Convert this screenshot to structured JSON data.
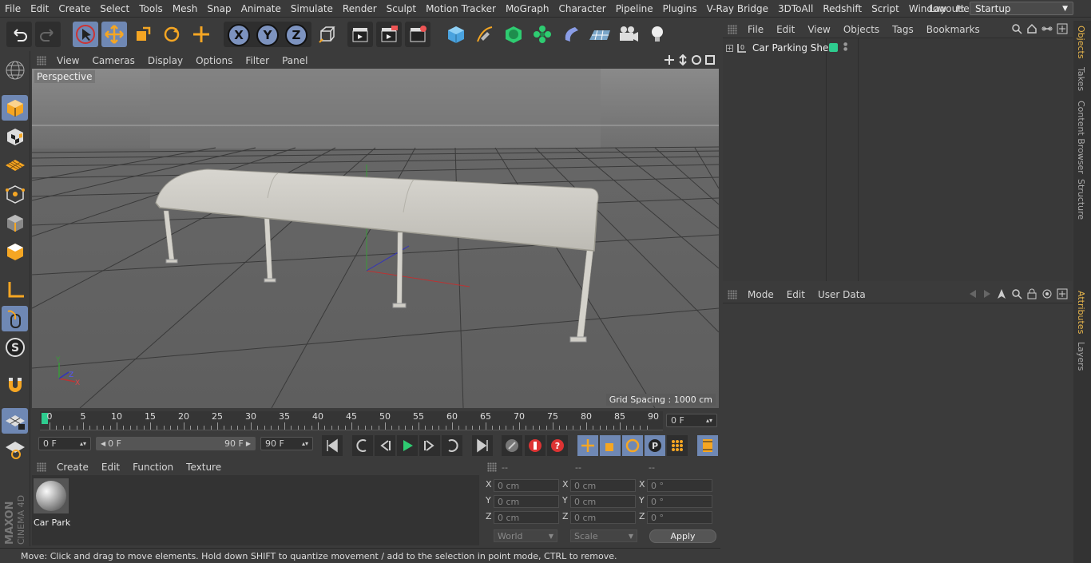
{
  "menubar": {
    "items": [
      "File",
      "Edit",
      "Create",
      "Select",
      "Tools",
      "Mesh",
      "Snap",
      "Animate",
      "Simulate",
      "Render",
      "Sculpt",
      "Motion Tracker",
      "MoGraph",
      "Character",
      "Pipeline",
      "Plugins",
      "V-Ray Bridge",
      "3DToAll",
      "Redshift",
      "Script",
      "Window",
      "Help"
    ],
    "layout_label": "Layout:",
    "layout_value": "Startup"
  },
  "toolbar": {
    "axis_x": "X",
    "axis_y": "Y",
    "axis_z": "Z"
  },
  "viewport": {
    "menu": [
      "View",
      "Cameras",
      "Display",
      "Options",
      "Filter",
      "Panel"
    ],
    "label": "Perspective",
    "grid_spacing": "Grid Spacing : 1000 cm",
    "axis_y": "Y",
    "axis_z": "Z",
    "axis_x": "X"
  },
  "timeline": {
    "ticks": [
      "0",
      "5",
      "10",
      "15",
      "20",
      "25",
      "30",
      "35",
      "40",
      "45",
      "50",
      "55",
      "60",
      "65",
      "70",
      "75",
      "80",
      "85",
      "90"
    ],
    "current_frame": "0 F"
  },
  "transport": {
    "start_field": "0 F",
    "range_start": "0 F",
    "range_end": "90 F",
    "end_field": "90 F"
  },
  "materials": {
    "menu": [
      "Create",
      "Edit",
      "Function",
      "Texture"
    ],
    "items": [
      {
        "name": "Car Park"
      }
    ]
  },
  "coordinates": {
    "headers": [
      "--",
      "--",
      "--"
    ],
    "rows": [
      {
        "axis": "X",
        "pos": "0 cm",
        "size_axis": "X",
        "size": "0 cm",
        "rot_axis": "X",
        "rot": "0 °"
      },
      {
        "axis": "Y",
        "pos": "0 cm",
        "size_axis": "Y",
        "size": "0 cm",
        "rot_axis": "Y",
        "rot": "0 °"
      },
      {
        "axis": "Z",
        "pos": "0 cm",
        "size_axis": "Z",
        "size": "0 cm",
        "rot_axis": "Z",
        "rot": "0 °"
      }
    ],
    "mode_select": "World",
    "scale_select": "Scale",
    "apply_label": "Apply"
  },
  "status": "Move: Click and drag to move elements. Hold down SHIFT to quantize movement / add to the selection in point mode, CTRL to remove.",
  "objects": {
    "menu": [
      "File",
      "Edit",
      "View",
      "Objects",
      "Tags",
      "Bookmarks"
    ],
    "items": [
      {
        "name": "Car Parking Shed",
        "layer_color": "#2ecc8f"
      }
    ]
  },
  "attributes": {
    "menu": [
      "Mode",
      "Edit",
      "User Data"
    ]
  },
  "right_tabs": [
    "Objects",
    "Takes",
    "Content Browser",
    "Structure",
    "Attributes",
    "Layers"
  ],
  "brand": {
    "maxon": "MAXON",
    "product": "CINEMA 4D"
  },
  "colors": {
    "accent": "#6f88b4",
    "timeline_marker": "#2ecc8f",
    "tab_active": "#e8b64c"
  }
}
